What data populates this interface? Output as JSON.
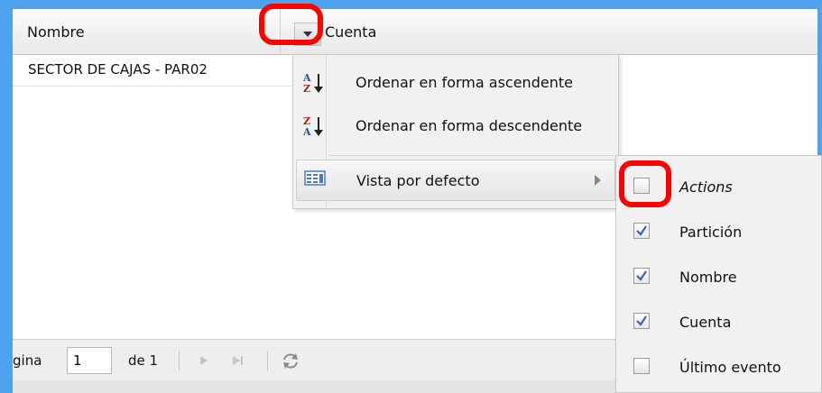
{
  "grid": {
    "columns": [
      {
        "label": "Nombre"
      },
      {
        "label": "Cuenta"
      }
    ],
    "rows": [
      {
        "nombre": "SECTOR DE CAJAS - PAR02"
      }
    ]
  },
  "column_menu": {
    "items": [
      {
        "label": "Ordenar en forma ascendente",
        "icon": "sort-ascending-icon"
      },
      {
        "label": "Ordenar en forma descendente",
        "icon": "sort-descending-icon"
      },
      {
        "label": "Vista por defecto",
        "icon": "columns-view-icon"
      }
    ]
  },
  "columns_submenu": {
    "items": [
      {
        "label": "Actions",
        "checked": false
      },
      {
        "label": "Partición",
        "checked": true
      },
      {
        "label": "Nombre",
        "checked": true
      },
      {
        "label": "Cuenta",
        "checked": true
      },
      {
        "label": "Último evento",
        "checked": false
      }
    ]
  },
  "paging": {
    "page_label": "gina",
    "page_value": "1",
    "of_label": "de 1"
  },
  "colors": {
    "frame": "#4da3f0",
    "highlight": "#ff0000",
    "check": "#3b5fc4"
  }
}
